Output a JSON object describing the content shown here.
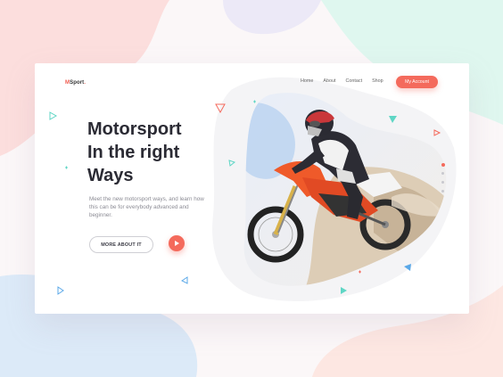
{
  "brand": {
    "logo_prefix": "M",
    "logo_main": "Sport",
    "logo_dot": "."
  },
  "nav": {
    "items": [
      "Home",
      "About",
      "Contact",
      "Shop"
    ],
    "account_button": "My Account"
  },
  "hero": {
    "headline_lines": [
      "Motorsport",
      "In the right",
      "Ways"
    ],
    "description": "Meet the new motorsport ways, and learn how this can be for everybody advanced and beginner.",
    "more_button": "MORE ABOUT IT",
    "play_button_icon": "play-icon"
  },
  "slider": {
    "count": 4,
    "active_index": 0
  },
  "colors": {
    "accent": "#f46a5c",
    "heading": "#2b2b34",
    "teal": "#5fd6c5",
    "blue": "#5aa8e8"
  }
}
